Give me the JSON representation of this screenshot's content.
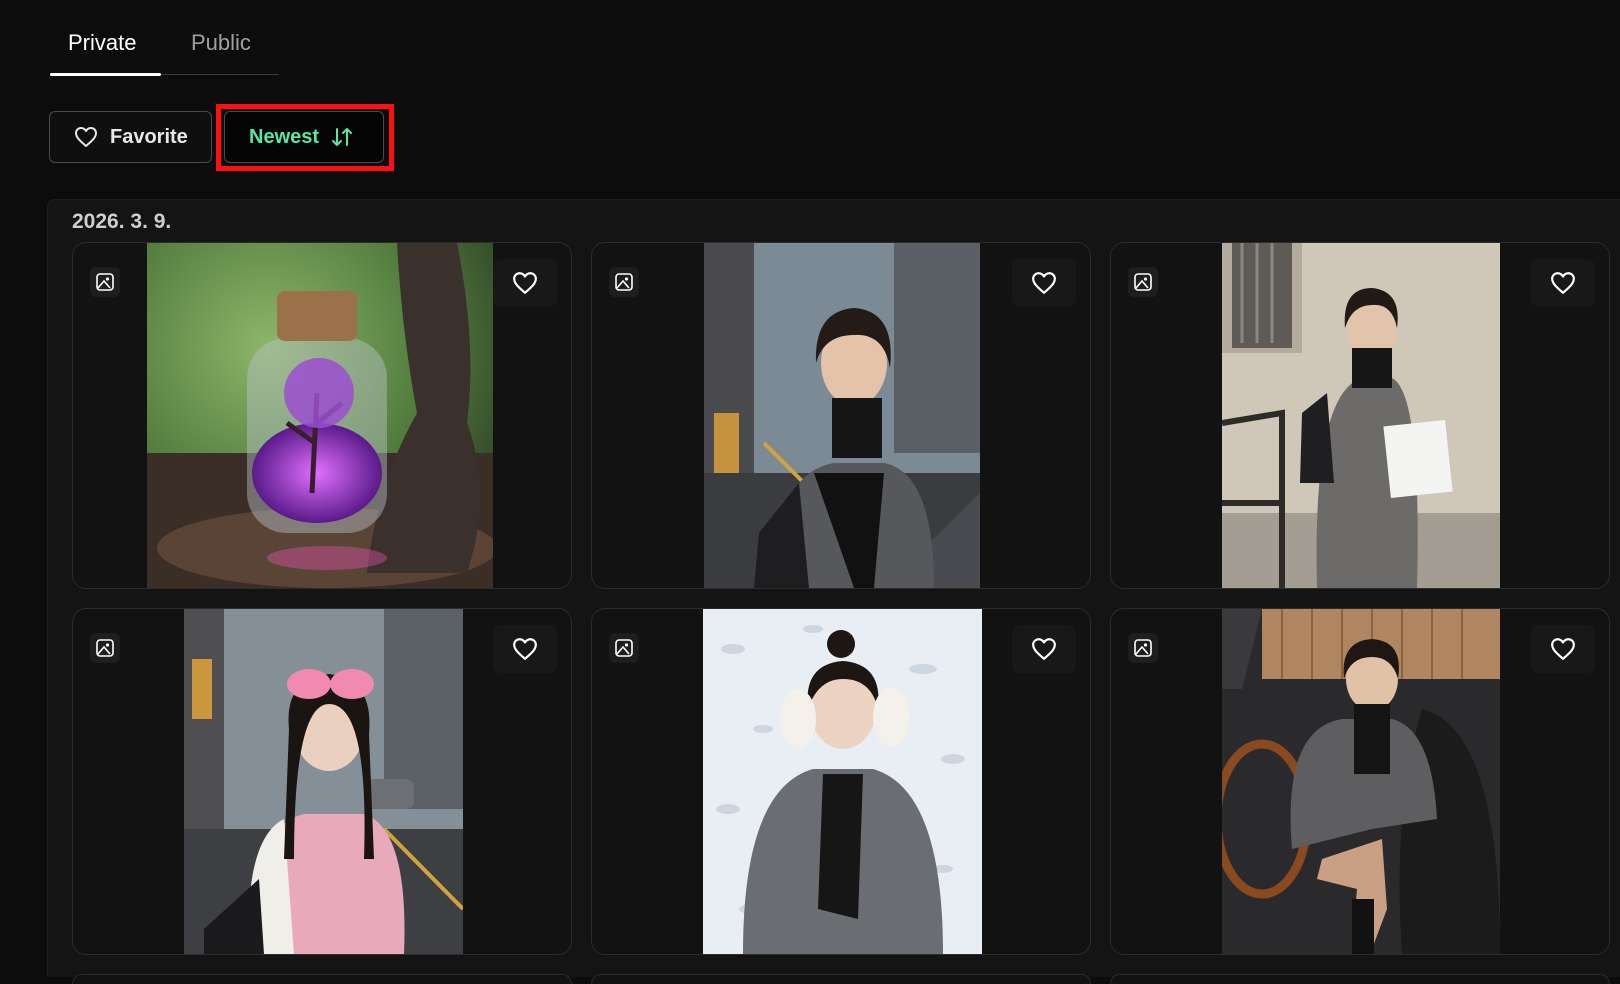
{
  "tabs": [
    {
      "label": "Private",
      "active": true
    },
    {
      "label": "Public",
      "active": false
    }
  ],
  "filters": {
    "favorite_label": "Favorite",
    "sort_label": "Newest",
    "sort_icon": "sort-arrows-icon",
    "favorite_icon": "heart-icon"
  },
  "colors": {
    "background": "#0c0c0c",
    "accent": "#57e6a3",
    "highlight": "#ff1010"
  },
  "gallery": {
    "date": "2026. 3. 9.",
    "items": [
      {
        "subject": "purple tree in glass jar",
        "favorite": false
      },
      {
        "subject": "woman in gray coat on city street",
        "favorite": false
      },
      {
        "subject": "woman with phone and shopping bag",
        "favorite": false
      },
      {
        "subject": "girl in pink varsity jacket with goggles",
        "favorite": false
      },
      {
        "subject": "woman in snow making heart hands",
        "favorite": false
      },
      {
        "subject": "woman sitting in vintage car",
        "favorite": false
      }
    ]
  }
}
